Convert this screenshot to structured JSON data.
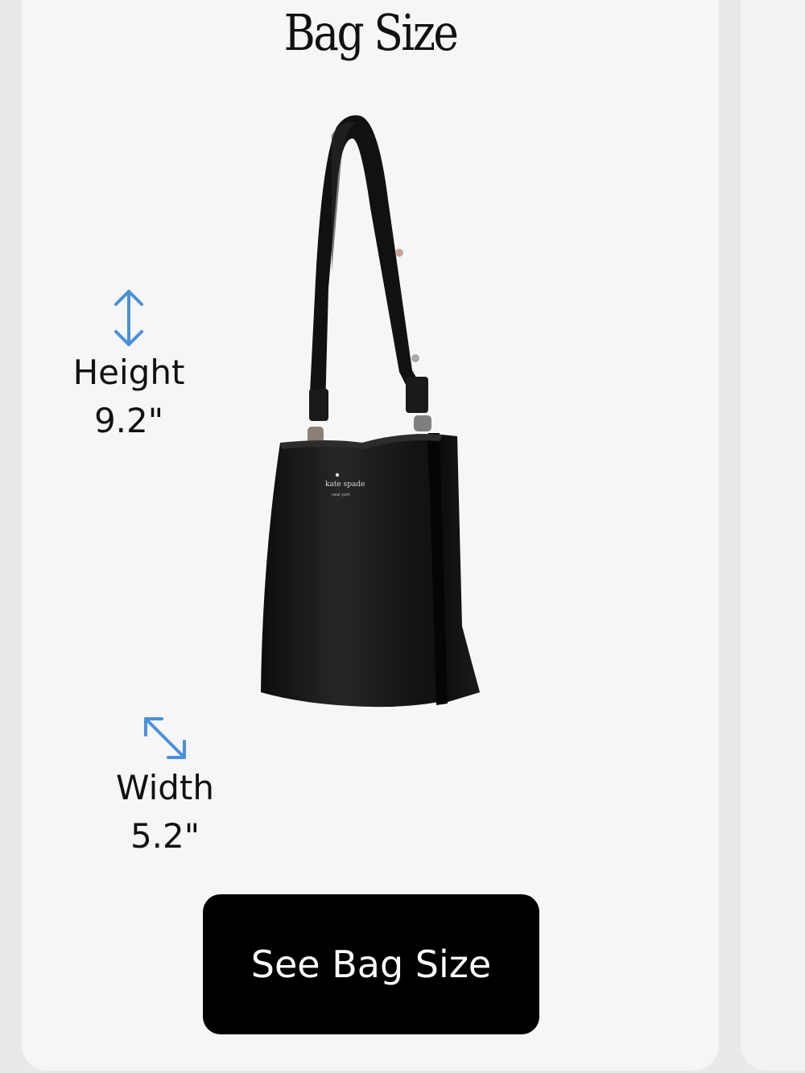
{
  "card": {
    "title": "Bag Size",
    "height": {
      "label": "Height",
      "value": "9.2\"",
      "icon": "vertical-double-arrow-icon"
    },
    "width": {
      "label": "Width",
      "value": "5.2\"",
      "icon": "diagonal-double-arrow-icon"
    },
    "image": {
      "alt": "black leather bucket bag",
      "brand_mark": "kate spade"
    },
    "cta_label": "See Bag Size"
  },
  "colors": {
    "accent_arrow": "#4a90d9",
    "button_bg": "#000000",
    "button_text": "#ffffff",
    "card_bg": "#f6f6f6"
  }
}
